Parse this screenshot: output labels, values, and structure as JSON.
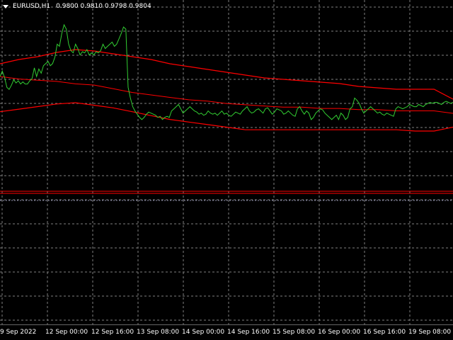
{
  "header": {
    "symbol": "EURUSD,H1",
    "ohlc": "0.9800 0.9810 0.9798 0.9804"
  },
  "time_axis": {
    "labels": [
      "9 Sep 2022",
      "12 Sep 00:00",
      "12 Sep 16:00",
      "13 Sep 08:00",
      "14 Sep 00:00",
      "14 Sep 16:00",
      "15 Sep 08:00",
      "16 Sep 00:00",
      "16 Sep 16:00",
      "19 Sep 08:00"
    ]
  },
  "colors": {
    "background": "#000000",
    "grid": "#808080",
    "price_line": "#32cd32",
    "envelope": "#ff0000",
    "text": "#ffffff"
  },
  "chart_data": {
    "type": "line",
    "grid": true,
    "series": [
      {
        "role": "price",
        "values": [
          0.5,
          0.55,
          0.49,
          0.4,
          0.38,
          0.42,
          0.47,
          0.44,
          0.46,
          0.43,
          0.45,
          0.43,
          0.43,
          0.46,
          0.48,
          0.58,
          0.5,
          0.57,
          0.53,
          0.6,
          0.62,
          0.64,
          0.6,
          0.62,
          0.68,
          0.8,
          0.78,
          0.9,
          0.98,
          0.94,
          0.8,
          0.74,
          0.72,
          0.8,
          0.76,
          0.7,
          0.73,
          0.72,
          0.75,
          0.7,
          0.72,
          0.7,
          0.73,
          0.72,
          0.74,
          0.8,
          0.76,
          0.78,
          0.8,
          0.82,
          0.78,
          0.8,
          0.85,
          0.9,
          0.96,
          0.94,
          0.4,
          0.3,
          0.22,
          0.18,
          0.15,
          0.12,
          0.1,
          0.12,
          0.15,
          0.17,
          0.16,
          0.15,
          0.14,
          0.12,
          0.13,
          0.1,
          0.12,
          0.13,
          0.12,
          0.18,
          0.2,
          0.22,
          0.24,
          0.2,
          0.16,
          0.18,
          0.2,
          0.22,
          0.2,
          0.18,
          0.17,
          0.15,
          0.16,
          0.14,
          0.15,
          0.18,
          0.16,
          0.15,
          0.16,
          0.14,
          0.16,
          0.18,
          0.15,
          0.16,
          0.14,
          0.13,
          0.15,
          0.17,
          0.16,
          0.15,
          0.18,
          0.2,
          0.22,
          0.18,
          0.16,
          0.17,
          0.19,
          0.2,
          0.18,
          0.16,
          0.2,
          0.21,
          0.18,
          0.15,
          0.17,
          0.2,
          0.19,
          0.18,
          0.15,
          0.16,
          0.18,
          0.16,
          0.14,
          0.13,
          0.2,
          0.22,
          0.18,
          0.15,
          0.18,
          0.16,
          0.1,
          0.12,
          0.16,
          0.18,
          0.2,
          0.19,
          0.16,
          0.14,
          0.12,
          0.1,
          0.12,
          0.14,
          0.1,
          0.16,
          0.14,
          0.1,
          0.12,
          0.2,
          0.22,
          0.3,
          0.28,
          0.25,
          0.2,
          0.16,
          0.18,
          0.2,
          0.22,
          0.2,
          0.18,
          0.16,
          0.17,
          0.15,
          0.14,
          0.16,
          0.15,
          0.14,
          0.13,
          0.2,
          0.22,
          0.21,
          0.2,
          0.21,
          0.22,
          0.24,
          0.23,
          0.22,
          0.22,
          0.24,
          0.23,
          0.22,
          0.24,
          0.25,
          0.26,
          0.25,
          0.26,
          0.26,
          0.25,
          0.24,
          0.26,
          0.27,
          0.26,
          0.25,
          0.26
        ]
      },
      {
        "role": "envelope-upper",
        "values": [
          0.9,
          0.93,
          0.95,
          0.98,
          1.0,
          0.99,
          0.97,
          0.95,
          0.93,
          0.9,
          0.88,
          0.86,
          0.84,
          0.82,
          0.8,
          0.79,
          0.78,
          0.77,
          0.76,
          0.74,
          0.73,
          0.72,
          0.72,
          0.72,
          0.65
        ]
      },
      {
        "role": "envelope-middle",
        "values": [
          0.8,
          0.78,
          0.77,
          0.76,
          0.74,
          0.73,
          0.7,
          0.67,
          0.65,
          0.63,
          0.61,
          0.6,
          0.58,
          0.57,
          0.56,
          0.55,
          0.55,
          0.54,
          0.54,
          0.53,
          0.53,
          0.52,
          0.52,
          0.52,
          0.5
        ]
      },
      {
        "role": "envelope-lower",
        "values": [
          0.66,
          0.68,
          0.7,
          0.72,
          0.73,
          0.71,
          0.69,
          0.66,
          0.63,
          0.6,
          0.58,
          0.56,
          0.54,
          0.52,
          0.52,
          0.52,
          0.52,
          0.52,
          0.52,
          0.52,
          0.52,
          0.52,
          0.51,
          0.51,
          0.54
        ]
      },
      {
        "role": "level-lines",
        "values": [
          0.0,
          -0.03
        ]
      }
    ]
  }
}
